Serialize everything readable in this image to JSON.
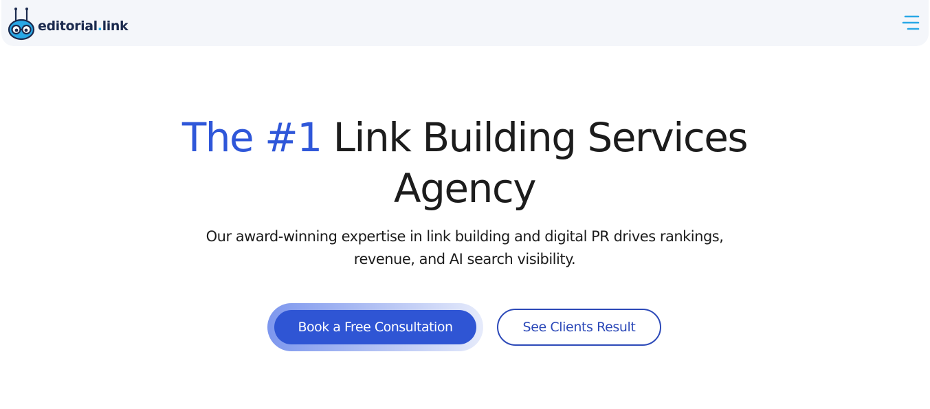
{
  "header": {
    "logo": {
      "icon": "robot-mascot-icon",
      "name": "editorial",
      "dot": ".",
      "tld": "link"
    },
    "menu_icon": "hamburger-menu-icon"
  },
  "hero": {
    "title_accent": "The #1",
    "title_rest": " Link Building Services Agency",
    "subtitle": "Our award-winning expertise in link building and digital PR drives rankings, revenue, and AI search visibility.",
    "primary_cta": "Book a Free Consultation",
    "secondary_cta": "See Clients Result"
  },
  "colors": {
    "accent": "#2f57d9",
    "primary_button": "#2f55d4",
    "secondary_border": "#2c49b8",
    "header_bg": "#f4f6fa",
    "logo_dot": "#29a8e6",
    "menu_icon": "#29a8e6",
    "text": "#1c1c1c"
  }
}
